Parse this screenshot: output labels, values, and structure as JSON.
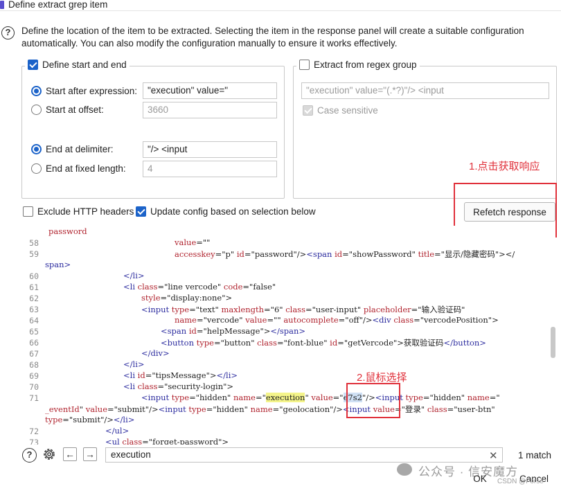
{
  "window": {
    "title": "Define extract grep item"
  },
  "description": "Define the location of the item to be extracted. Selecting the item in the response panel will create a suitable configuration automatically. You can also modify the configuration manually to ensure it works effectively.",
  "start_end": {
    "legend": "Define start and end",
    "start_after_label": "Start after expression:",
    "start_after_value": "\"execution\" value=\"",
    "start_offset_label": "Start at offset:",
    "start_offset_value": "3660",
    "end_delim_label": "End at delimiter:",
    "end_delim_value": "\"/> <input",
    "end_fixed_label": "End at fixed length:",
    "end_fixed_value": "4"
  },
  "regex_group": {
    "legend": "Extract from regex group",
    "regex_value": "\"execution\" value=\"(.*?)\"/> <input",
    "case_sensitive_label": "Case sensitive"
  },
  "options": {
    "exclude_headers_label": "Exclude HTTP headers",
    "update_config_label": "Update config based on selection below",
    "refetch_label": "Refetch response"
  },
  "annotations": {
    "step1": "1.点击获取响应",
    "step2": "2.鼠标选择"
  },
  "code": {
    "lines": [
      {
        "n": "",
        "text": "password"
      },
      {
        "n": "58",
        "text": "value=\"\""
      },
      {
        "n": "59",
        "text": "accesskey=\"p\" id=\"password\"/><span id=\"showPassword\" title=\"显示/隐藏密码\"></"
      },
      {
        "n": "",
        "text": "span>"
      },
      {
        "n": "60",
        "text": "</li>"
      },
      {
        "n": "61",
        "text": "<li class=\"line vercode\" code=\"false\""
      },
      {
        "n": "62",
        "text": "style=\"display:none\">"
      },
      {
        "n": "63",
        "text": "<input type=\"text\" maxlength=\"6\" class=\"user-input\" placeholder=\"输入验证码\""
      },
      {
        "n": "64",
        "text": "name=\"vercode\" value=\"\" autocomplete=\"off\"/><div class=\"vercodePosition\">"
      },
      {
        "n": "65",
        "text": "<span id=\"helpMessage\"></span>"
      },
      {
        "n": "66",
        "text": "<button type=\"button\" class=\"font-blue\" id=\"getVercode\">获取验证码</button>"
      },
      {
        "n": "67",
        "text": "</div>"
      },
      {
        "n": "68",
        "text": "</li>"
      },
      {
        "n": "69",
        "text": "<li id=\"tipsMessage\"></li>"
      },
      {
        "n": "70",
        "text": "<li class=\"security-login\">"
      },
      {
        "n": "71",
        "text": "<input type=\"hidden\" name=\"execution\" value=\"e7s2\"/><input type=\"hidden\" name=\""
      },
      {
        "n": "",
        "text": "_eventId\" value=\"submit\"/><input type=\"hidden\" name=\"geolocation\"/><input value=\"登录\" class=\"user-btn\""
      },
      {
        "n": "",
        "text": "type=\"submit\"/></li>"
      },
      {
        "n": "72",
        "text": "</ul>"
      },
      {
        "n": "73",
        "text": "<ul class=\"forget-password\">"
      }
    ]
  },
  "search": {
    "value": "execution",
    "match_count": "1 match"
  },
  "buttons": {
    "ok": "OK",
    "cancel": "Cancel"
  },
  "watermark": {
    "text": "公众号 · 信安魔方",
    "small": "CSDN @Forse"
  },
  "colors": {
    "accent": "#1c63c9",
    "annotation": "#e0303a",
    "highlight": "#f4f48a"
  }
}
